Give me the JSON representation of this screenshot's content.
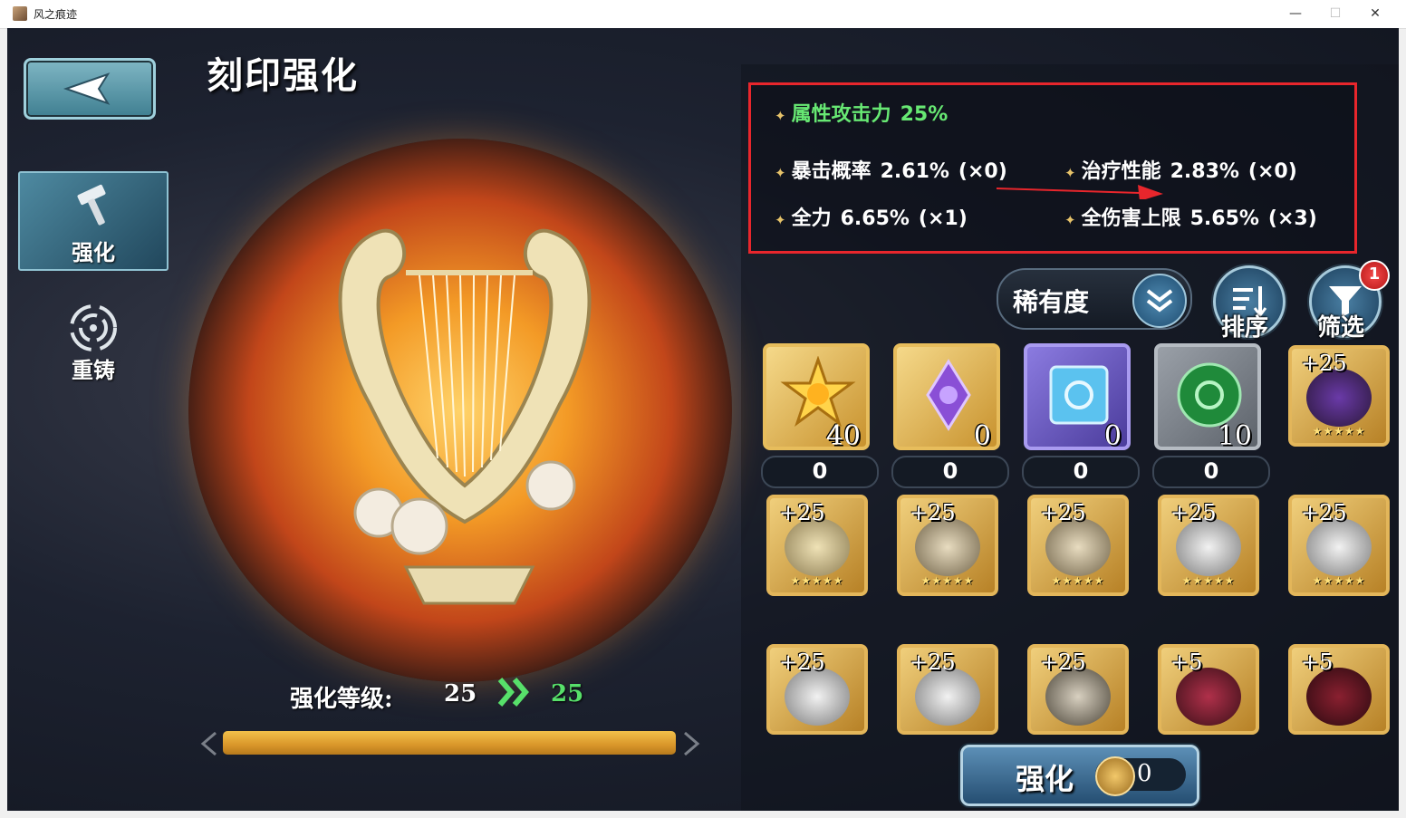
{
  "window": {
    "title": "风之痕迹",
    "minimize": "—",
    "maximize": "☐",
    "close": "✕"
  },
  "page": {
    "title": "刻印强化"
  },
  "nav": {
    "upgrade_label": "强化",
    "recast_label": "重铸"
  },
  "stats": {
    "main": {
      "name": "属性攻击力",
      "value": "25%"
    },
    "sub": [
      {
        "name": "暴击概率",
        "value": "2.61%",
        "mult": "(×0)"
      },
      {
        "name": "治疗性能",
        "value": "2.83%",
        "mult": "(×0)"
      },
      {
        "name": "全力",
        "value": "6.65%",
        "mult": "(×1)"
      },
      {
        "name": "全伤害上限",
        "value": "5.65%",
        "mult": "(×3)"
      }
    ]
  },
  "controls": {
    "rarity_label": "稀有度",
    "sort_label": "排序",
    "filter_label": "筛选",
    "filter_badge": "1"
  },
  "materials": [
    {
      "name": "gold-star-material",
      "count": "40",
      "selected": "0"
    },
    {
      "name": "purple-gem-material",
      "count": "0",
      "selected": "0"
    },
    {
      "name": "blue-cube-material",
      "count": "0",
      "selected": "0"
    },
    {
      "name": "green-orb-material",
      "count": "10",
      "selected": "0"
    }
  ],
  "items": [
    {
      "plus": "+25",
      "stars": "★★★★★"
    },
    {
      "plus": "+25",
      "stars": "★★★★★"
    },
    {
      "plus": "+25",
      "stars": "★★★★★"
    },
    {
      "plus": "+25",
      "stars": "★★★★★"
    },
    {
      "plus": "+25",
      "stars": "★★★★★"
    },
    {
      "plus": "+25",
      "stars": "★★★★★"
    },
    {
      "plus": "+25",
      "stars": ""
    },
    {
      "plus": "+25",
      "stars": ""
    },
    {
      "plus": "+25",
      "stars": ""
    },
    {
      "plus": "+5",
      "stars": ""
    },
    {
      "plus": "+5",
      "stars": ""
    }
  ],
  "level": {
    "label": "强化等级:",
    "from": "25",
    "to": "25",
    "progress_fraction": 1.0
  },
  "upgrade_button": {
    "label": "强化",
    "cost": "0"
  },
  "colors": {
    "highlight_box": "#e8262c",
    "green_text": "#67e873",
    "gold_frame": "#e3b65a"
  }
}
